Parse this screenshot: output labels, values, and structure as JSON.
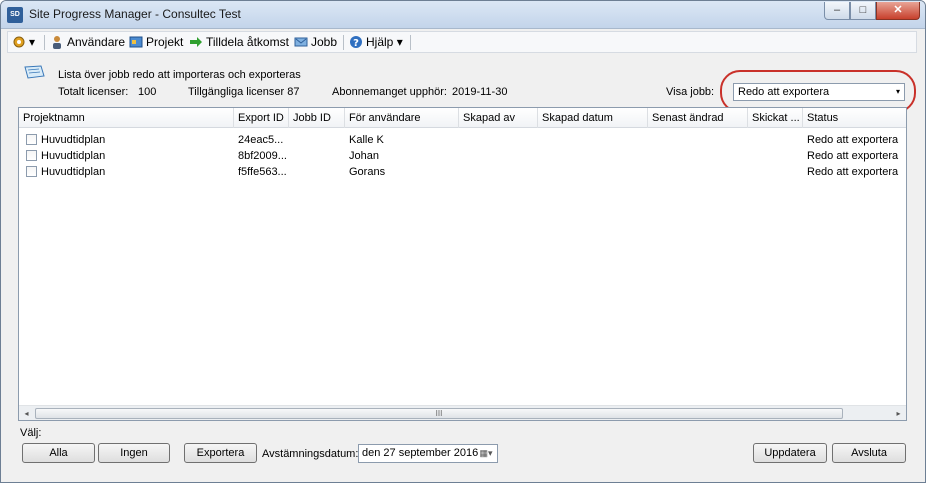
{
  "window": {
    "title": "Site Progress Manager - Consultec Test",
    "app_icon_text": "SD",
    "minimize": "–",
    "maximize": "□",
    "close": "✕"
  },
  "toolbar": {
    "settings_caret": "▾",
    "users": "Användare",
    "projects": "Projekt",
    "assign_access": "Tilldela åtkomst",
    "jobs": "Jobb",
    "help": "Hjälp",
    "help_caret": "▾"
  },
  "header": {
    "description": "Lista över jobb redo att importeras och exporteras",
    "total_licenses_label": "Totalt licenser:",
    "total_licenses_value": "100",
    "available_licenses": "Tillgängliga licenser 87",
    "subscription_expires_label": "Abonnemanget upphör:",
    "subscription_expires_value": "2019-11-30",
    "show_jobs_label": "Visa jobb:",
    "show_jobs_selected": "Redo att exportera",
    "caret": "▾"
  },
  "grid": {
    "columns": [
      "Projektnamn",
      "Export ID",
      "Jobb ID",
      "För användare",
      "Skapad av",
      "Skapad datum",
      "Senast ändrad",
      "Skickat ...",
      "Status"
    ],
    "rows": [
      {
        "project": "Huvudtidplan",
        "export_id": "24eac5...",
        "job_id": "",
        "for_user": "Kalle K",
        "created_by": "",
        "created_date": "",
        "last_modified": "",
        "sent": "",
        "status": "Redo att exportera"
      },
      {
        "project": "Huvudtidplan",
        "export_id": "8bf2009...",
        "job_id": "",
        "for_user": "Johan",
        "created_by": "",
        "created_date": "",
        "last_modified": "",
        "sent": "",
        "status": "Redo att exportera"
      },
      {
        "project": "Huvudtidplan",
        "export_id": "f5ffe563...",
        "job_id": "",
        "for_user": "Gorans",
        "created_by": "",
        "created_date": "",
        "last_modified": "",
        "sent": "",
        "status": "Redo att exportera"
      }
    ],
    "scroll_left": "◂",
    "scroll_right": "▸",
    "scroll_grip": "III"
  },
  "footer": {
    "select_label": "Välj:",
    "all_button": "Alla",
    "none_button": "Ingen",
    "export_button": "Exportera",
    "reconciliation_label": "Avstämningsdatum:",
    "reconciliation_date": "den 27 september 2016",
    "calendar_glyph": "▦▾",
    "update_button": "Uppdatera",
    "close_button": "Avsluta"
  }
}
